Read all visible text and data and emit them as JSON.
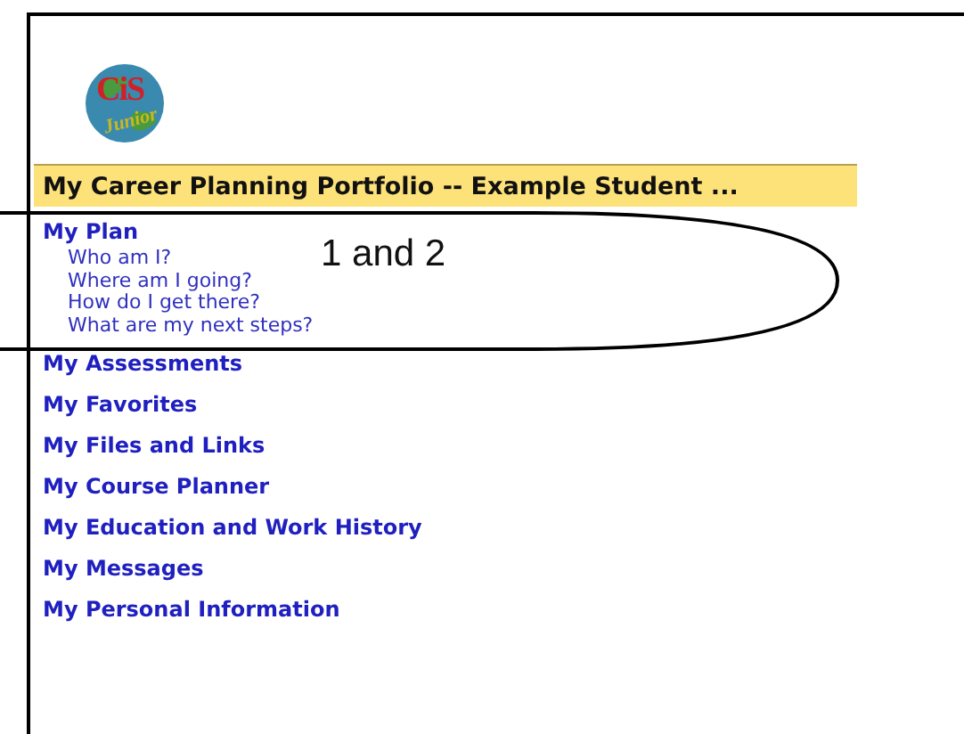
{
  "logo": {
    "name": "CiS",
    "tagline": "Junior"
  },
  "title": {
    "main": "My Career Planning Portfolio",
    "rest": "-- Example Student ..."
  },
  "nav": [
    {
      "label": "My Plan",
      "children": [
        {
          "label": "Who am I?"
        },
        {
          "label": "Where am I going?"
        },
        {
          "label": "How do I get there?"
        },
        {
          "label": "What are my next steps?"
        }
      ]
    },
    {
      "label": "My Assessments"
    },
    {
      "label": "My Favorites"
    },
    {
      "label": "My Files and Links"
    },
    {
      "label": "My Course Planner"
    },
    {
      "label": "My Education and Work History"
    },
    {
      "label": "My Messages"
    },
    {
      "label": "My Personal Information"
    }
  ],
  "annotation": {
    "label": "1 and 2"
  }
}
